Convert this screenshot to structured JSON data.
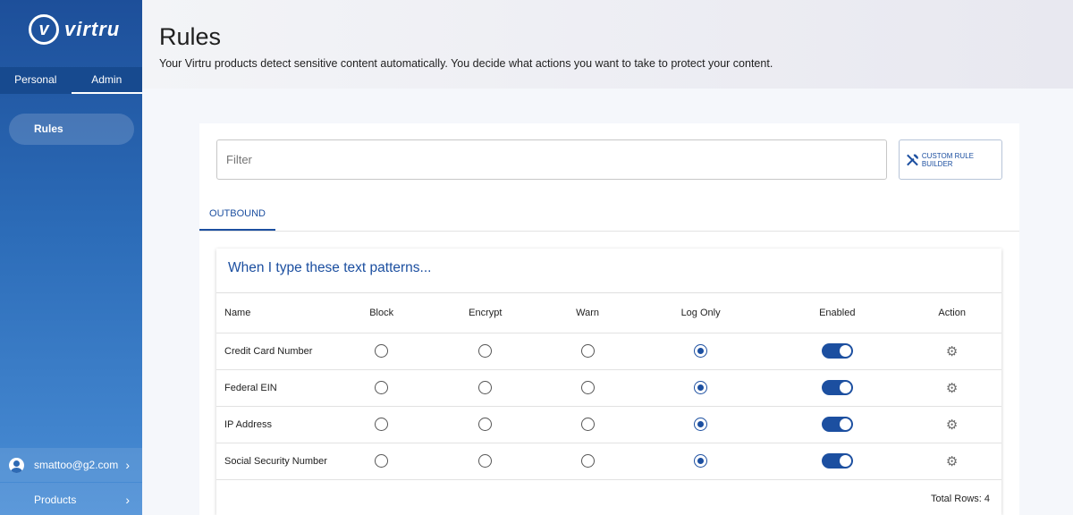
{
  "sidebar": {
    "logo_mark": "v",
    "logo_text": "virtru",
    "tabs": [
      {
        "label": "Personal"
      },
      {
        "label": "Admin"
      }
    ],
    "active_tab": "Admin",
    "items": [
      {
        "label": "Rules"
      }
    ],
    "user_email": "smattoo@g2.com",
    "products_label": "Products"
  },
  "header": {
    "title": "Rules",
    "subtitle": "Your Virtru products detect sensitive content automatically. You decide what actions you want to take to protect your content."
  },
  "main": {
    "filter_placeholder": "Filter",
    "custom_rule_builder_label": "CUSTOM RULE BUILDER",
    "tabs": [
      {
        "label": "OUTBOUND"
      }
    ],
    "card_title": "When I type these text patterns...",
    "columns": [
      "Name",
      "Block",
      "Encrypt",
      "Warn",
      "Log Only",
      "Enabled",
      "Action"
    ],
    "rows": [
      {
        "name": "Credit Card Number",
        "selected": "Log Only",
        "enabled": true
      },
      {
        "name": "Federal EIN",
        "selected": "Log Only",
        "enabled": true
      },
      {
        "name": "IP Address",
        "selected": "Log Only",
        "enabled": true
      },
      {
        "name": "Social Security Number",
        "selected": "Log Only",
        "enabled": true
      }
    ],
    "total_rows": "Total Rows: 4"
  },
  "colors": {
    "accent": "#1c4fa0",
    "sidebar_top": "#1d4f9a",
    "sidebar_bottom": "#4a8ed6"
  },
  "icons": {
    "custom_rule_builder": "tools-icon",
    "action": "gear-icon",
    "user": "account-circle-icon",
    "chevron": "chevron-right-icon"
  }
}
